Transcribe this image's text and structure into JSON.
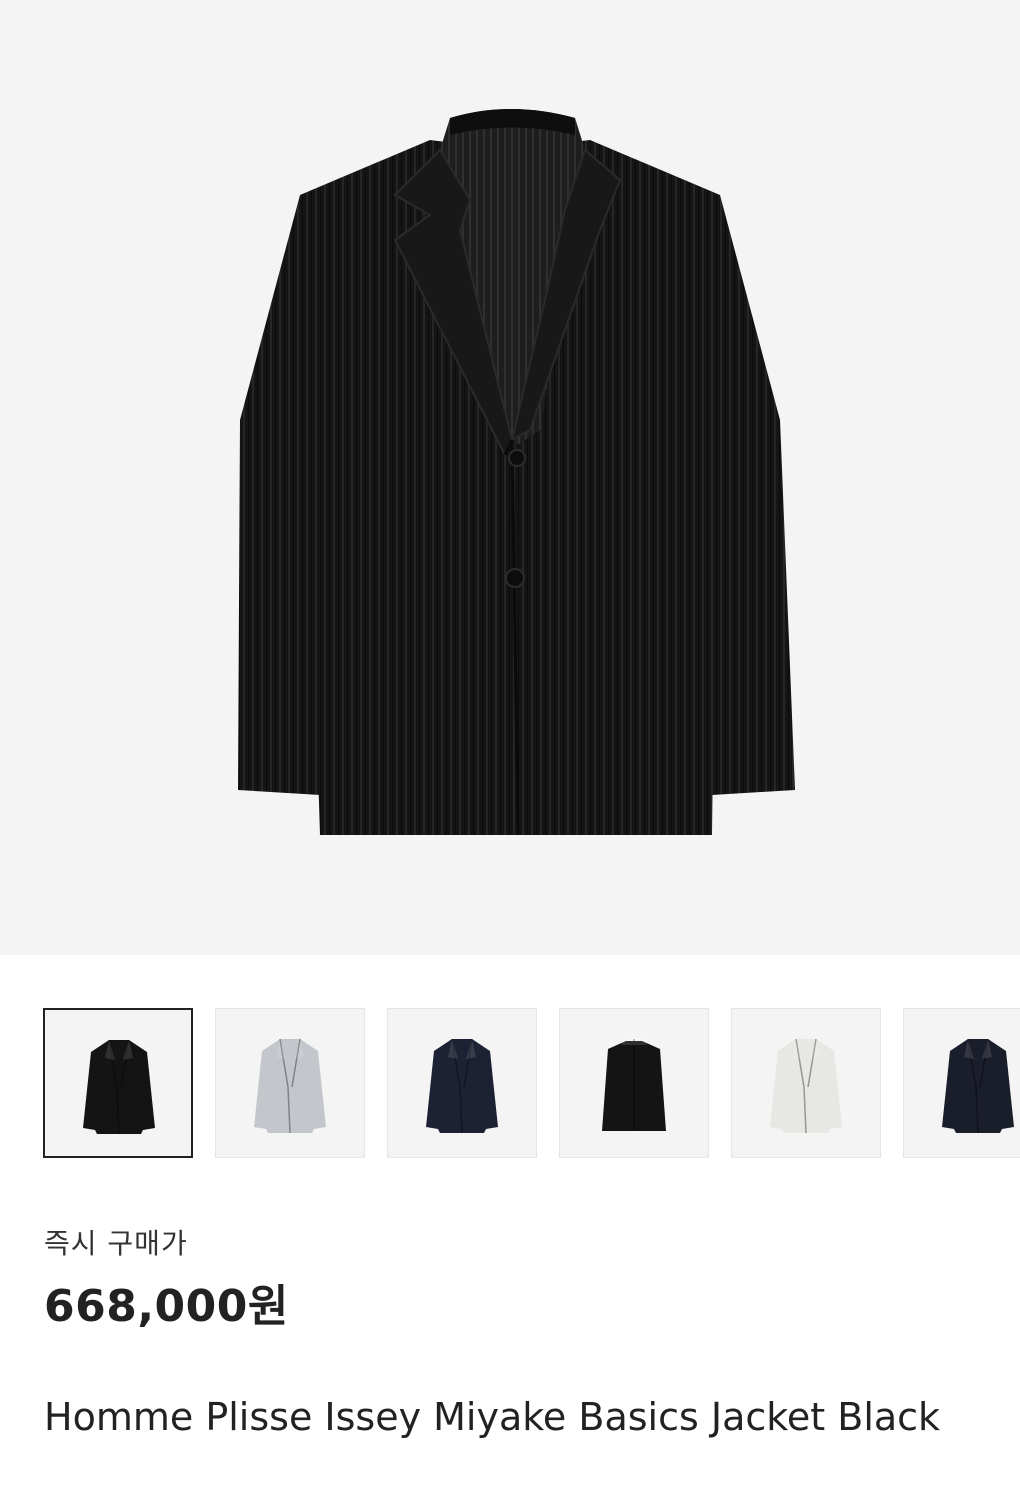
{
  "product": {
    "image_alt": "Homme Plisse Issey Miyake Basics Jacket Black",
    "price_label": "즉시 구매가",
    "price": "668,000원",
    "name": "Homme Plisse Issey Miyake Basics Jacket Black"
  },
  "thumbnails": [
    {
      "color": "#141414",
      "style": "blazer",
      "selected": true
    },
    {
      "color": "#c3c7cc",
      "style": "blazer",
      "selected": false
    },
    {
      "color": "#1c2233",
      "style": "blazer",
      "selected": false
    },
    {
      "color": "#141414",
      "style": "zip",
      "selected": false
    },
    {
      "color": "#e7e7e4",
      "style": "blazer",
      "selected": false
    },
    {
      "color": "#1a1d2a",
      "style": "blazer",
      "selected": false
    }
  ],
  "colors": {
    "background": "#ffffff",
    "image_background": "#f4f4f4",
    "text": "#222222",
    "jacket": "#141414"
  }
}
